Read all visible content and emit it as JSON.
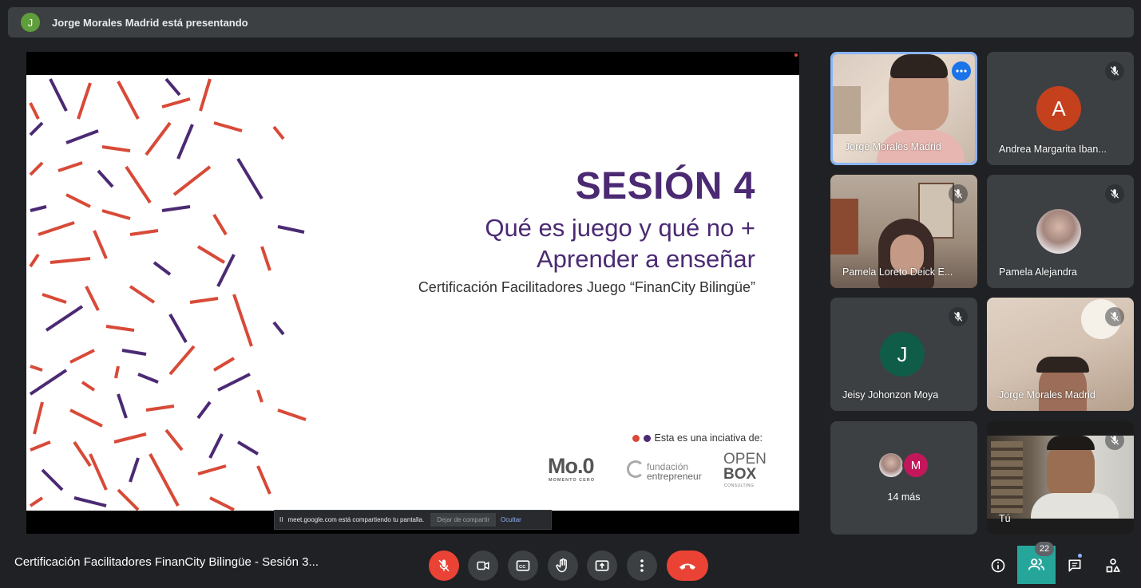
{
  "banner": {
    "avatar_letter": "J",
    "text": "Jorge Morales Madrid está presentando"
  },
  "slide": {
    "title": "SESIÓN 4",
    "subtitle_line1": "Qué es juego y qué no +",
    "subtitle_line2": "Aprender a enseñar",
    "small": "Certificación Facilitadores Juego “FinanCity Bilingüe”",
    "initiative": "Esta es una inciativa de:",
    "logo_moo": "Mo.0",
    "logo_moo_sub": "MOMENTO CERO",
    "logo_fund_1": "fundación",
    "logo_fund_2": "entrepreneur",
    "logo_open_1": "OPEN",
    "logo_open_2": "BOX",
    "logo_open_3": "CONSULTING",
    "colors": {
      "purple": "#4b2a73",
      "red": "#d84a38"
    }
  },
  "share_bar": {
    "text": "meet.google.com está compartiendo tu pantalla.",
    "stop_label": "Dejar de compartir",
    "hide_label": "Ocultar"
  },
  "participants": [
    {
      "name": "Jorge Morales Madrid",
      "type": "video",
      "active": true
    },
    {
      "name": "Andrea Margarita Iban...",
      "type": "avatar",
      "letter": "A",
      "color": "#c5401d",
      "muted": true
    },
    {
      "name": "Pamela Loreto Deick E...",
      "type": "video",
      "muted": true
    },
    {
      "name": "Pamela Alejandra",
      "type": "photo",
      "muted": true
    },
    {
      "name": "Jeisy Johonzon Moya",
      "type": "avatar",
      "letter": "J",
      "color": "#0f5c48",
      "muted": true
    },
    {
      "name": "Jorge Morales Madrid",
      "type": "video",
      "muted": true
    },
    {
      "name": "14 más",
      "type": "more",
      "letter": "M",
      "color": "#c2185b"
    },
    {
      "name": "Tú",
      "type": "video",
      "muted": true
    }
  ],
  "bottom": {
    "meeting_title": "Certificación Facilitadores FinanCity Bilingüe - Sesión 3...",
    "people_count": "22",
    "icons": [
      "mic-off-icon",
      "camera-icon",
      "captions-icon",
      "raise-hand-icon",
      "present-icon",
      "more-icon",
      "end-call-icon",
      "info-icon",
      "people-icon",
      "chat-icon",
      "activities-icon"
    ]
  }
}
